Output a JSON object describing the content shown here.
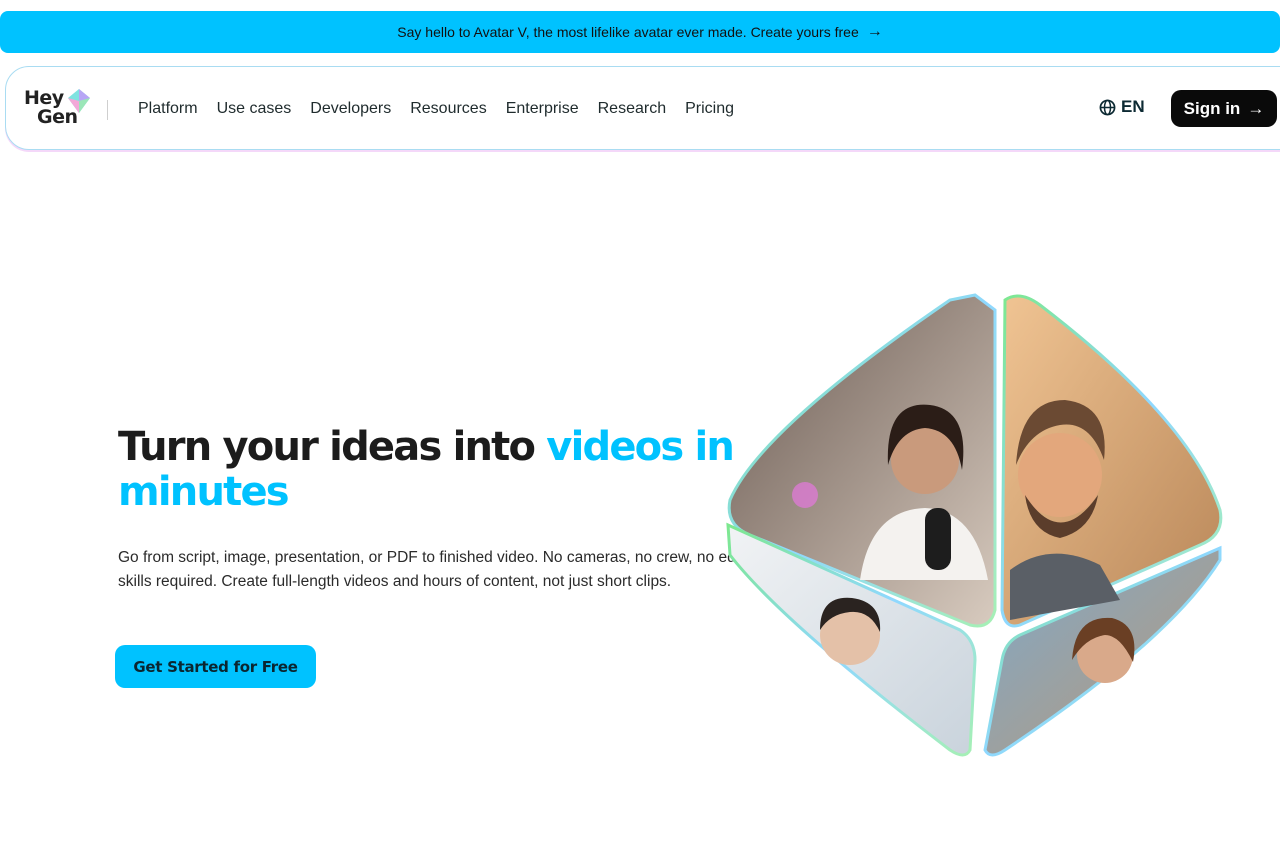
{
  "announcement": {
    "text": "Say hello to Avatar V, the most lifelike avatar ever made. Create yours free",
    "arrow": "→"
  },
  "header": {
    "logo": {
      "line1": "Hey",
      "line2": "Gen"
    },
    "nav_items": [
      "Platform",
      "Use cases",
      "Developers",
      "Resources",
      "Enterprise",
      "Research",
      "Pricing"
    ],
    "language": "EN",
    "signin_label": "Sign in",
    "signin_arrow": "→"
  },
  "hero": {
    "title_part1": "Turn your ideas into ",
    "title_accent": "videos in minutes",
    "subtitle": "Go from script, image, presentation, or PDF to finished video. No cameras, no crew, no editing skills required. Create full-length videos and hours of content, not just short clips.",
    "cta_label": "Get Started for Free"
  },
  "colors": {
    "accent": "#00c2ff",
    "signin_bg": "#0a0a0a",
    "text": "#1c1c1c"
  },
  "icons": [
    "logo-gem-icon",
    "globe-icon",
    "arrow-right-icon"
  ]
}
